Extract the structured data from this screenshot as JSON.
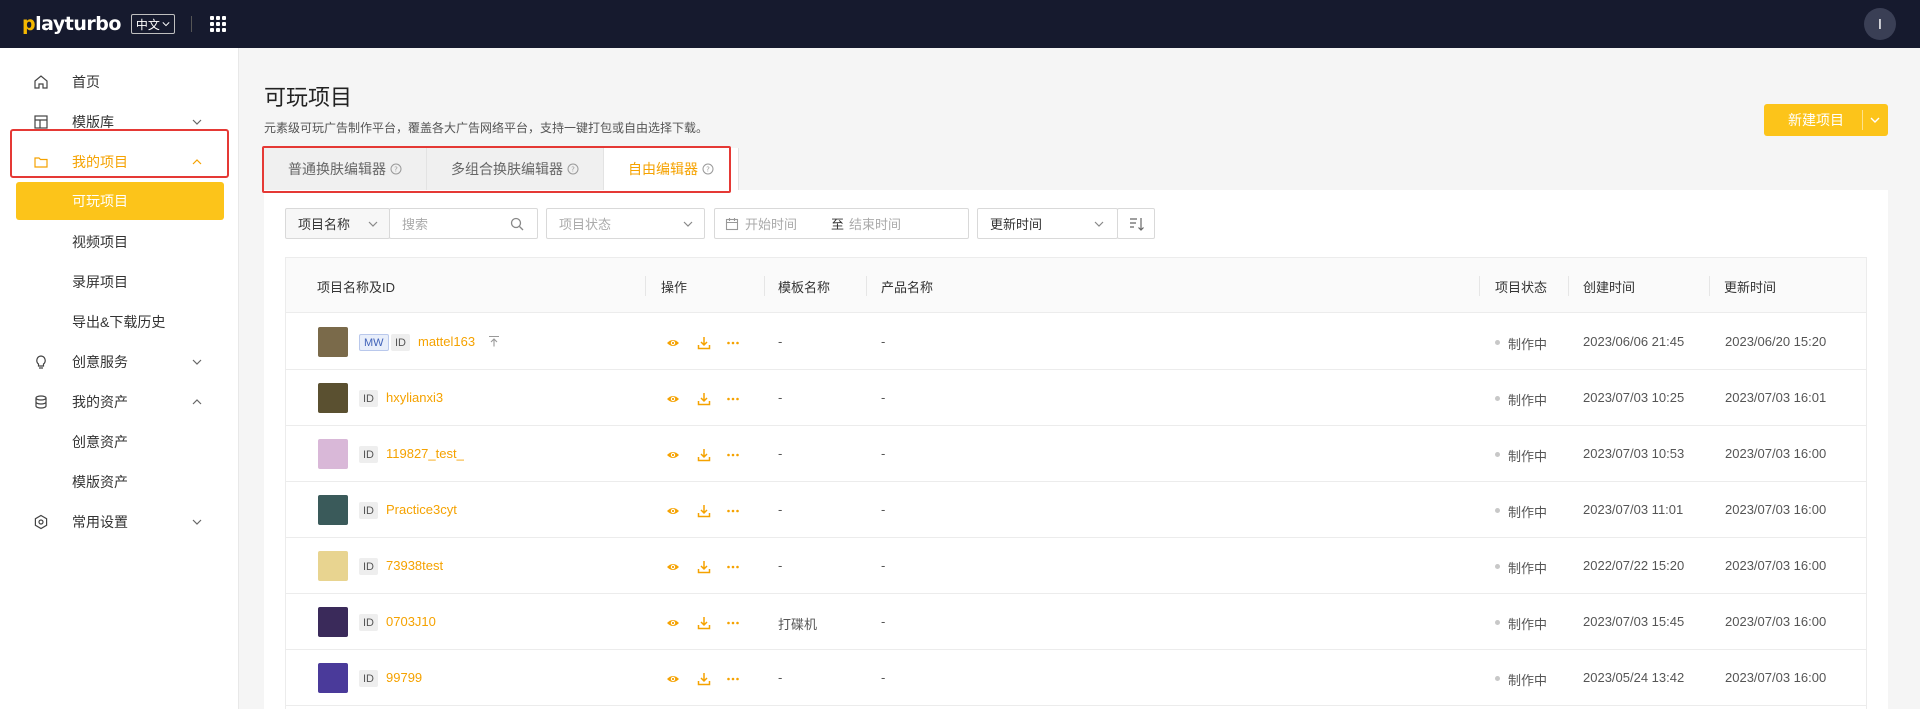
{
  "topbar": {
    "logo_prefix": "p",
    "logo_rest": "layturbo",
    "lang": "中文",
    "avatar_letter": "I"
  },
  "sidebar": {
    "items": [
      {
        "label": "首页",
        "icon": "home-icon"
      },
      {
        "label": "模版库",
        "icon": "template-icon"
      },
      {
        "label": "我的项目",
        "icon": "folder-icon"
      },
      {
        "label": "可玩项目"
      },
      {
        "label": "视频项目"
      },
      {
        "label": "录屏项目"
      },
      {
        "label": "导出&下载历史"
      },
      {
        "label": "创意服务",
        "icon": "bulb-icon"
      },
      {
        "label": "我的资产",
        "icon": "database-icon"
      },
      {
        "label": "创意资产"
      },
      {
        "label": "模版资产"
      },
      {
        "label": "常用设置",
        "icon": "settings-icon"
      }
    ]
  },
  "page": {
    "title": "可玩项目",
    "description": "元素级可玩广告制作平台，覆盖各大广告网络平台，支持一键打包或自由选择下载。",
    "new_button": "新建项目"
  },
  "tabs": [
    {
      "label": "普通换肤编辑器"
    },
    {
      "label": "多组合换肤编辑器"
    },
    {
      "label": "自由编辑器"
    }
  ],
  "filters": {
    "name_select": "项目名称",
    "search_placeholder": "搜索",
    "status_placeholder": "项目状态",
    "start_placeholder": "开始时间",
    "to": "至",
    "end_placeholder": "结束时间",
    "sort_select": "更新时间"
  },
  "table": {
    "columns": [
      "项目名称及ID",
      "操作",
      "模板名称",
      "产品名称",
      "项目状态",
      "创建时间",
      "更新时间"
    ],
    "rows": [
      {
        "tags": [
          "MW",
          "ID"
        ],
        "name": "mattel163",
        "pinned": true,
        "template": "-",
        "product": "-",
        "status": "制作中",
        "created": "2023/06/06 21:45",
        "updated": "2023/06/20 15:20",
        "thumb_color": "#7a6a4a"
      },
      {
        "tags": [
          "ID"
        ],
        "name": "hxylianxi3",
        "pinned": false,
        "template": "-",
        "product": "-",
        "status": "制作中",
        "created": "2023/07/03 10:25",
        "updated": "2023/07/03 16:01",
        "thumb_color": "#5a5030"
      },
      {
        "tags": [
          "ID"
        ],
        "name": "119827_test_",
        "pinned": false,
        "template": "-",
        "product": "-",
        "status": "制作中",
        "created": "2023/07/03 10:53",
        "updated": "2023/07/03 16:00",
        "thumb_color": "#d9b8d8"
      },
      {
        "tags": [
          "ID"
        ],
        "name": "Practice3cyt",
        "pinned": false,
        "template": "-",
        "product": "-",
        "status": "制作中",
        "created": "2023/07/03 11:01",
        "updated": "2023/07/03 16:00",
        "thumb_color": "#3a5a5a"
      },
      {
        "tags": [
          "ID"
        ],
        "name": "73938test",
        "pinned": false,
        "template": "-",
        "product": "-",
        "status": "制作中",
        "created": "2022/07/22 15:20",
        "updated": "2023/07/03 16:00",
        "thumb_color": "#e8d490"
      },
      {
        "tags": [
          "ID"
        ],
        "name": "0703J10",
        "pinned": false,
        "template": "打碟机",
        "product": "-",
        "status": "制作中",
        "created": "2023/07/03 15:45",
        "updated": "2023/07/03 16:00",
        "thumb_color": "#3a2a5a"
      },
      {
        "tags": [
          "ID"
        ],
        "name": "99799",
        "pinned": false,
        "template": "-",
        "product": "-",
        "status": "制作中",
        "created": "2023/05/24 13:42",
        "updated": "2023/07/03 16:00",
        "thumb_color": "#4a3a9a"
      }
    ]
  },
  "colors": {
    "accent": "#fcc41a",
    "link": "#f5a200",
    "topbar": "#161a2e",
    "highlight": "#e53935"
  }
}
